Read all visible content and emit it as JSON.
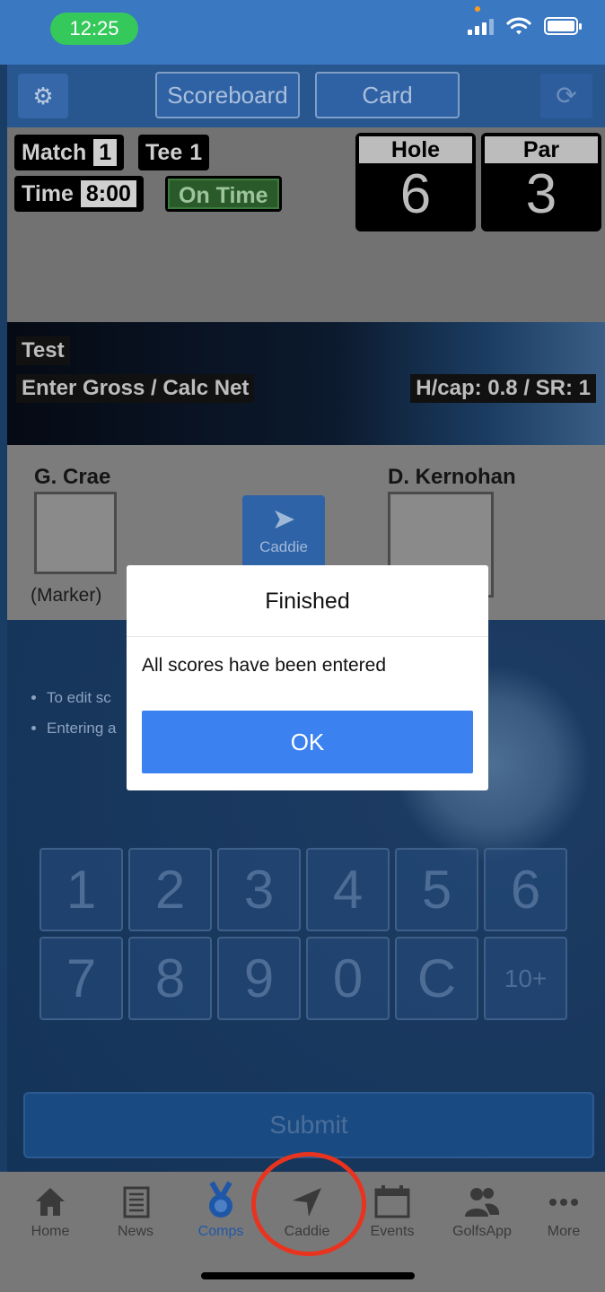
{
  "status_bar": {
    "time": "12:25"
  },
  "toolbar": {
    "scoreboard_label": "Scoreboard",
    "card_label": "Card"
  },
  "info": {
    "match_label": "Match",
    "match_value": "1",
    "tee_label": "Tee",
    "tee_value": "1",
    "time_label": "Time",
    "time_value": "8:00",
    "status": "On Time",
    "hole_label": "Hole",
    "hole_value": "6",
    "par_label": "Par",
    "par_value": "3"
  },
  "banner": {
    "comp_name": "Test",
    "mode": "Enter Gross / Calc Net",
    "handicap": "H/cap: 0.8 / SR: 1"
  },
  "players": {
    "left_name": "G. Crae",
    "left_role": "(Marker)",
    "right_name": "D. Kernohan"
  },
  "caddie_button": {
    "label": "Caddie"
  },
  "hints": [
    "To edit sc",
    "Entering a"
  ],
  "keypad": [
    "1",
    "2",
    "3",
    "4",
    "5",
    "6",
    "7",
    "8",
    "9",
    "0",
    "C",
    "10+"
  ],
  "submit_label": "Submit",
  "tabs": [
    {
      "label": "Home",
      "icon": "home-icon"
    },
    {
      "label": "News",
      "icon": "news-icon"
    },
    {
      "label": "Comps",
      "icon": "medal-icon"
    },
    {
      "label": "Caddie",
      "icon": "navigation-arrow-icon"
    },
    {
      "label": "Events",
      "icon": "calendar-icon"
    },
    {
      "label": "GolfsApp",
      "icon": "people-icon"
    },
    {
      "label": "More",
      "icon": "more-dots-icon"
    }
  ],
  "dialog": {
    "title": "Finished",
    "message": "All scores have been entered",
    "ok_label": "OK"
  },
  "colors": {
    "accent": "#3b82f0",
    "highlight_circle": "#e8341e",
    "active_tab": "#1f57a8"
  }
}
